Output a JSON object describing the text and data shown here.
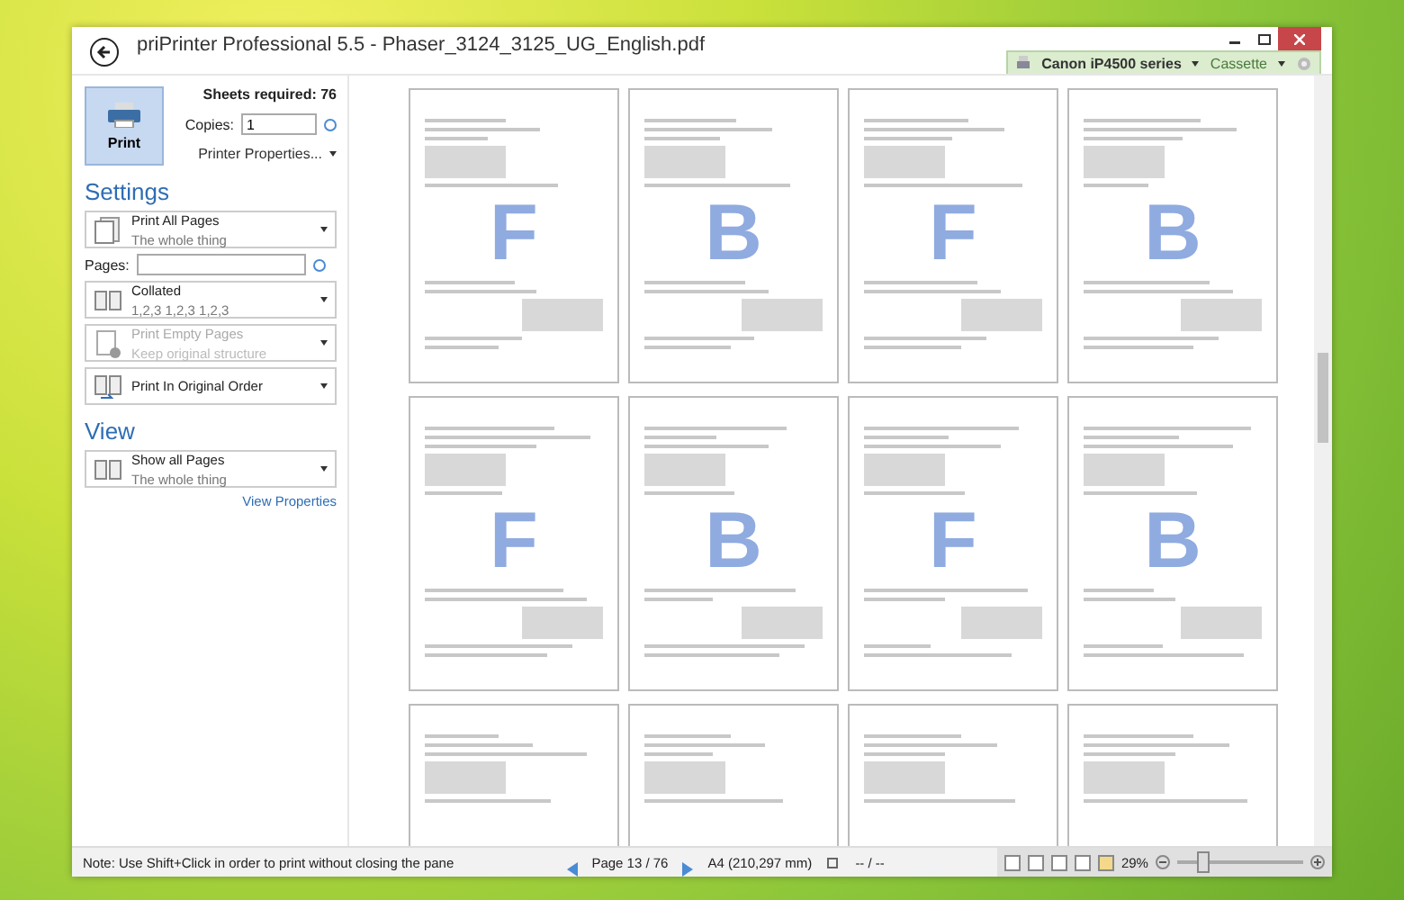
{
  "window": {
    "title": "priPrinter Professional 5.5 - Phaser_3124_3125_UG_English.pdf"
  },
  "printer_bar": {
    "printer": "Canon iP4500 series",
    "tray": "Cassette"
  },
  "print_panel": {
    "print_button": "Print",
    "sheets_required": "Sheets required: 76",
    "copies_label": "Copies:",
    "copies_value": "1",
    "printer_properties": "Printer Properties..."
  },
  "settings": {
    "heading": "Settings",
    "pages_label": "Pages:",
    "dropdowns": [
      {
        "kind": "pages",
        "title": "Print All Pages",
        "subtitle": "The whole thing",
        "disabled": false
      },
      {
        "kind": "collate",
        "title": "Collated",
        "subtitle": "1,2,3  1,2,3  1,2,3",
        "disabled": false
      },
      {
        "kind": "empty",
        "title": "Print Empty Pages",
        "subtitle": "Keep original structure",
        "disabled": true
      },
      {
        "kind": "order",
        "title": "Print In Original Order",
        "disabled": false
      }
    ]
  },
  "view": {
    "heading": "View",
    "dropdown": {
      "title": "Show all Pages",
      "subtitle": "The whole thing"
    },
    "link": "View Properties"
  },
  "pages": [
    {
      "letter": "F"
    },
    {
      "letter": "B"
    },
    {
      "letter": "F"
    },
    {
      "letter": "B"
    },
    {
      "letter": "F"
    },
    {
      "letter": "B"
    },
    {
      "letter": "F"
    },
    {
      "letter": "B"
    }
  ],
  "status_bar": {
    "note": "Note: Use Shift+Click in order to print without closing the pane",
    "page": "Page 13 / 76",
    "paper": "A4 (210,297 mm)",
    "range": "-- / --",
    "zoom": "29%",
    "zoom_slider": {
      "level": 0.2
    }
  }
}
